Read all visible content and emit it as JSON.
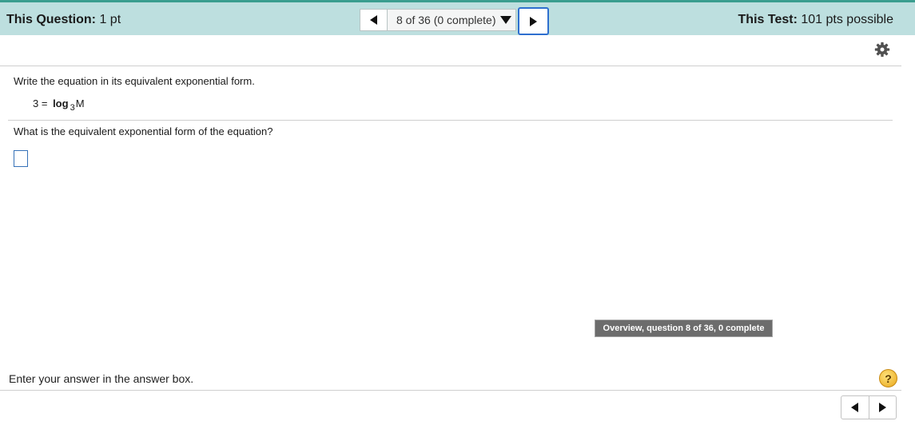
{
  "header": {
    "question_label": "This Question:",
    "question_points": "1 pt",
    "test_label": "This Test:",
    "test_points": "101 pts possible",
    "nav_status": "8 of 36 (0 complete)"
  },
  "question": {
    "prompt": "Write the equation in its equivalent exponential form.",
    "equation_lhs": "3 =",
    "equation_log": "log",
    "equation_base": "3",
    "equation_arg": "M",
    "subquestion": "What is the equivalent exponential form of the equation?",
    "answer_value": ""
  },
  "tooltip": "Overview, question 8 of 36, 0 complete",
  "footer": {
    "instruction": "Enter your answer in the answer box.",
    "help_symbol": "?"
  },
  "icons": [
    "prev-arrow-icon",
    "next-arrow-icon",
    "dropdown-caret-icon",
    "gear-icon",
    "help-icon"
  ],
  "colors": {
    "header_bg": "#bddfdf",
    "accent_line": "#3a9d8f",
    "focus_border": "#2e6fcf",
    "answer_box_border": "#3672b8"
  }
}
